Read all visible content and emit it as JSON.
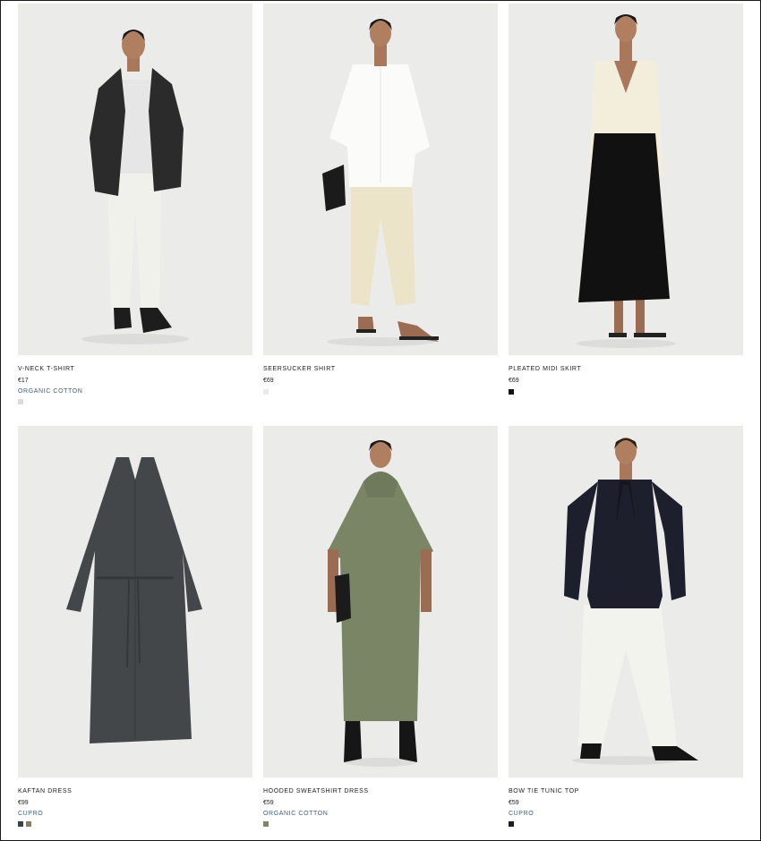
{
  "products": [
    {
      "name": "V-NECK T-SHIRT",
      "price": "€17",
      "fabric": "ORGANIC COTTON",
      "swatches": [
        "#dcdcdc"
      ],
      "image_icon": "model-blazer-white-trousers"
    },
    {
      "name": "SEERSUCKER SHIRT",
      "price": "€69",
      "fabric": "",
      "swatches": [
        "#e9e9e9"
      ],
      "image_icon": "model-white-shirt-beige-trousers"
    },
    {
      "name": "PLEATED MIDI SKIRT",
      "price": "€69",
      "fabric": "",
      "swatches": [
        "#111111"
      ],
      "image_icon": "model-cream-top-black-skirt"
    },
    {
      "name": "KAFTAN DRESS",
      "price": "€99",
      "fabric": "CUPRO",
      "swatches": [
        "#3c4046",
        "#8a7a66"
      ],
      "image_icon": "grey-kaftan-dress"
    },
    {
      "name": "HOODED SWEATSHIRT DRESS",
      "price": "€59",
      "fabric": "ORGANIC COTTON",
      "swatches": [
        "#7b8766"
      ],
      "image_icon": "model-green-hooded-dress"
    },
    {
      "name": "BOW TIE TUNIC TOP",
      "price": "€59",
      "fabric": "CUPRO",
      "swatches": [
        "#1b1d2a"
      ],
      "image_icon": "model-navy-tunic-white-trousers"
    }
  ]
}
